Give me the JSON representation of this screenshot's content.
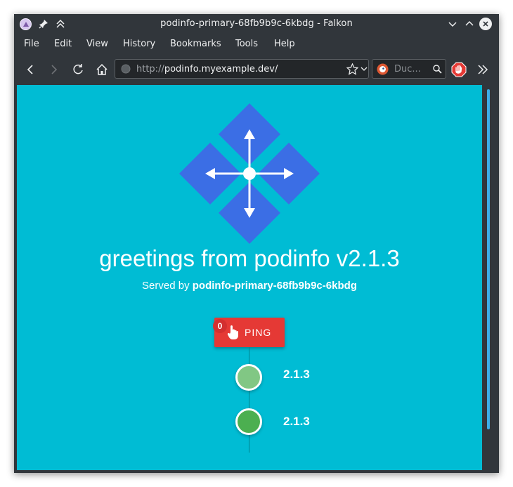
{
  "window": {
    "title": "podinfo-primary-68fb9b9c-6kbdg - Falkon"
  },
  "menu": [
    "File",
    "Edit",
    "View",
    "History",
    "Bookmarks",
    "Tools",
    "Help"
  ],
  "navigation": {
    "url_scheme": "http://",
    "url_host": "podinfo.myexample.dev/",
    "search_placeholder": "Duc..."
  },
  "page": {
    "greeting": "greetings from podinfo v2.1.3",
    "served_prefix": "Served by ",
    "served_host": "podinfo-primary-68fb9b9c-6kbdg",
    "ping_label": "PING",
    "ping_count": "0",
    "timeline": [
      {
        "version": "2.1.3",
        "color": "#81c784"
      },
      {
        "version": "2.1.3",
        "color": "#4caf50"
      }
    ]
  },
  "colors": {
    "background": "#00bcd4",
    "logo": "#3b6ee5",
    "ping": "#e53935",
    "chrome": "#31363b",
    "accent": "#3daee9"
  },
  "icons": [
    "app-icon",
    "pin-icon",
    "keep-above-icon",
    "minimize-icon",
    "maximize-icon",
    "close-icon",
    "back-icon",
    "forward-icon",
    "reload-icon",
    "home-icon",
    "globe-icon",
    "bookmark-star-icon",
    "dropdown-icon",
    "duckduckgo-icon",
    "search-icon",
    "adblock-icon",
    "more-tools-icon",
    "podinfo-logo-icon",
    "hand-pointer-icon"
  ]
}
